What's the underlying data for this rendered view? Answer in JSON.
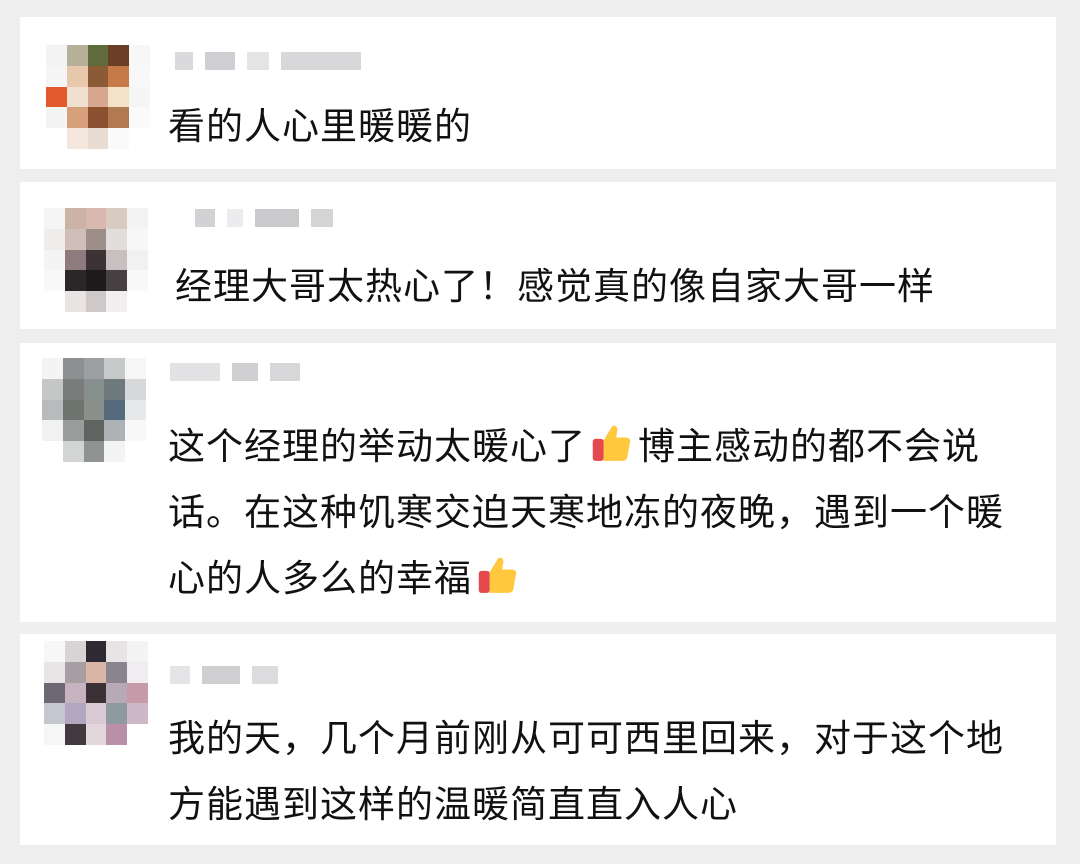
{
  "comments": [
    {
      "text": "看的人心里暖暖的"
    },
    {
      "text": "经理大哥太热心了！感觉真的像自家大哥一样"
    },
    {
      "text_part1": "这个经理的举动太暖心了",
      "text_part2": "博主感动的都不会说话。在这种饥寒交迫天寒地冻的夜晚，遇到一个暖心的人多么的幸福",
      "emoji": "thumbs-up-icon"
    },
    {
      "text": "我的天，几个月前刚从可可西里回来，对于这个地方能遇到这样的温暖简直直入人心"
    }
  ],
  "colors": {
    "background": "#eeeeef",
    "card": "#ffffff",
    "text": "#111111",
    "thumb_yellow": "#ffc83d",
    "thumb_red": "#e5484d"
  }
}
